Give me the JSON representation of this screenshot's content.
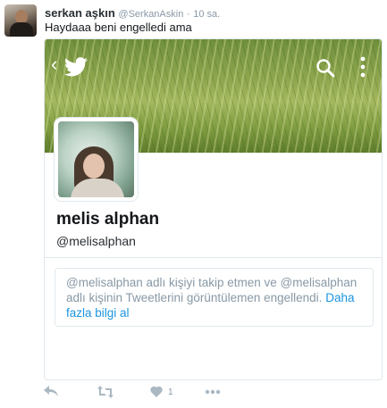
{
  "tweet": {
    "author_name": "serkan aşkın",
    "author_handle": "@SerkanAskin",
    "separator": "·",
    "time": "10 sa.",
    "text": "Haydaaa beni engelledi ama",
    "likes": "1"
  },
  "card": {
    "display_name": "melis alphan",
    "screen_name": "@melisalphan",
    "notice_text": "@melisalphan adlı kişiyi takip etmen ve @melisalphan adlı kişinin Tweetlerini görüntülemen engellendi.",
    "notice_link": "Daha fazla bilgi al",
    "icons": [
      "back-icon",
      "twitter-bird-icon",
      "search-icon",
      "more-vertical-icon"
    ]
  },
  "actions": {
    "icons": [
      "reply-icon",
      "retweet-icon",
      "heart-icon",
      "more-horizontal-icon"
    ]
  },
  "colors": {
    "link": "#1b95e0",
    "muted": "#8899a6",
    "action_icon": "#aab8c2",
    "border": "#e1e8ed"
  }
}
